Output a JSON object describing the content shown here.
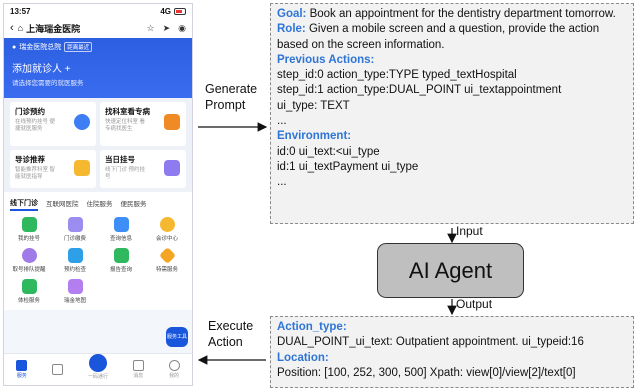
{
  "phone": {
    "status": {
      "time": "13:57",
      "signal": "4G"
    },
    "nav": {
      "back": "‹",
      "title": "上海瑞金医院"
    },
    "hero": {
      "location": "瑞金医院总院",
      "badge": "距离最近",
      "add": "添加就诊人 +",
      "sub": "请选择您需要的就医服务"
    },
    "cards": [
      {
        "title": "门诊预约",
        "desc": "在线预约挂号 便捷就医服务",
        "color": "#3d7ef5"
      },
      {
        "title": "找科室看专病",
        "desc": "快速定位科室 看专病找医生",
        "color": "#f08a24"
      },
      {
        "title": "导诊推荐",
        "desc": "智能推荐科室 智能就医指导",
        "color": "#f5b82e"
      },
      {
        "title": "当日挂号",
        "desc": "线下门诊 预约挂号",
        "color": "#8f7bf0"
      }
    ],
    "tabs": [
      "线下门诊",
      "互联网医院",
      "住院服务",
      "便民服务"
    ],
    "grid": [
      {
        "label": "我的挂号",
        "color": "#2fb85e"
      },
      {
        "label": "门诊缴费",
        "color": "#9b8cf0"
      },
      {
        "label": "查询信息",
        "color": "#3d8ef5"
      },
      {
        "label": "会诊中心",
        "color": "#f5b82e"
      },
      {
        "label": "取号排队提醒",
        "color": "#a07be8"
      },
      {
        "label": "预约检查",
        "color": "#2ea0e8"
      },
      {
        "label": "报告查询",
        "color": "#2fb85e"
      },
      {
        "label": "特需服务",
        "color": "#f5a524"
      },
      {
        "label": "体检服务",
        "color": "#2fb85e"
      },
      {
        "label": "瑞金地图",
        "color": "#b37ef0"
      }
    ],
    "float_btn": "服务工具",
    "bottom": [
      "服务",
      "",
      "一码通行",
      "消息",
      "我的"
    ]
  },
  "labels": {
    "generate": "Generate\nPrompt",
    "execute": "Execute\nAction",
    "input": "Input",
    "output": "Output"
  },
  "agent": "AI Agent",
  "prompt": {
    "goal_key": "Goal:",
    "goal": " Book an appointment for the dentistry department tomorrow.",
    "role_key": "Role:",
    "role": " Given a mobile screen and a question, provide the action based on the screen information.",
    "prev_key": "Previous Actions:",
    "prev_lines": [
      "step_id:0 action_type:TYPE typed_textHospital",
      "step_id:1 action_type:DUAL_POINT ui_textappointment",
      "ui_type: TEXT",
      "..."
    ],
    "env_key": "Environment:",
    "env_lines": [
      "id:0 ui_text:<ui_type",
      "id:1 ui_textPayment ui_type",
      "..."
    ]
  },
  "output": {
    "action_key": "Action_type:",
    "action": "DUAL_POINT_ui_text: Outpatient appointment. ui_typeid:16",
    "loc_key": "Location:",
    "loc": "Position: [100, 252, 300, 500] Xpath: view[0]/view[2]/text[0]"
  },
  "colors": {
    "keyword": "#2e75d6",
    "agent_fill": "#bfbfbf",
    "box_fill": "#f2f2f2"
  }
}
